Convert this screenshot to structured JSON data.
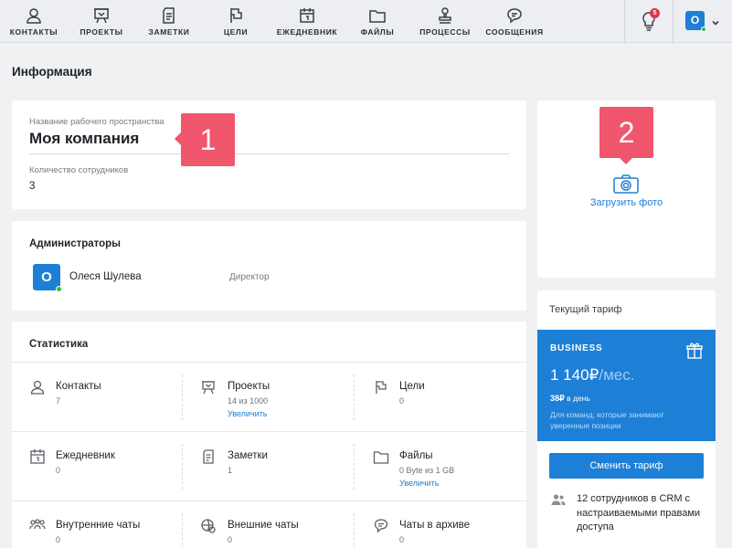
{
  "nav": {
    "items": [
      {
        "label": "КОНТАКТЫ",
        "icon": "user-icon"
      },
      {
        "label": "ПРОЕКТЫ",
        "icon": "easel-icon"
      },
      {
        "label": "ЗАМЕТКИ",
        "icon": "note-icon"
      },
      {
        "label": "ЦЕЛИ",
        "icon": "flag-icon"
      },
      {
        "label": "ЕЖЕДНЕВНИК",
        "icon": "calendar-icon"
      },
      {
        "label": "ФАЙЛЫ",
        "icon": "folder-icon"
      },
      {
        "label": "ПРОЦЕССЫ",
        "icon": "stamp-icon"
      },
      {
        "label": "СООБЩЕНИЯ",
        "icon": "chat-icon"
      }
    ],
    "notification_count": "5",
    "user_initial": "O"
  },
  "page": {
    "title": "Информация"
  },
  "workspace": {
    "name_label": "Название рабочего пространства",
    "name_value": "Моя компания",
    "employees_label": "Количество сотрудников",
    "employees_value": "3"
  },
  "markers": {
    "first": "1",
    "second": "2"
  },
  "photo": {
    "upload_label": "Загрузить фото"
  },
  "admins": {
    "title": "Администраторы",
    "list": [
      {
        "initial": "О",
        "name": "Олеся Шулева",
        "role": "Директор"
      }
    ]
  },
  "stats": {
    "title": "Статистика",
    "cells": [
      {
        "name": "Контакты",
        "value": "7",
        "link": ""
      },
      {
        "name": "Проекты",
        "value": "14 из 1000",
        "link": "Увеличить"
      },
      {
        "name": "Цели",
        "value": "0",
        "link": ""
      },
      {
        "name": "Ежедневник",
        "value": "0",
        "link": ""
      },
      {
        "name": "Заметки",
        "value": "1",
        "link": ""
      },
      {
        "name": "Файлы",
        "value": "0 Byte из 1 GB",
        "link": "Увеличить"
      },
      {
        "name": "Внутренние чаты",
        "value": "0",
        "link": ""
      },
      {
        "name": "Внешние чаты",
        "value": "0",
        "link": ""
      },
      {
        "name": "Чаты в архиве",
        "value": "0",
        "link": ""
      }
    ]
  },
  "tariff": {
    "current_label": "Текущий тариф",
    "plan_name": "BUSINESS",
    "price": "1 140₽",
    "price_period": "/мес.",
    "daily_price": "38₽",
    "daily_suffix": " в день",
    "description": "Для команд, которые занимают уверенные позиции",
    "change_button": "Сменить тариф",
    "feature": "12 сотрудников в CRM с настраиваемыми правами доступа"
  },
  "colors": {
    "accent": "#1e7fd6",
    "marker": "#f0566c",
    "online": "#2fbf4a",
    "badge": "#e2344a"
  }
}
